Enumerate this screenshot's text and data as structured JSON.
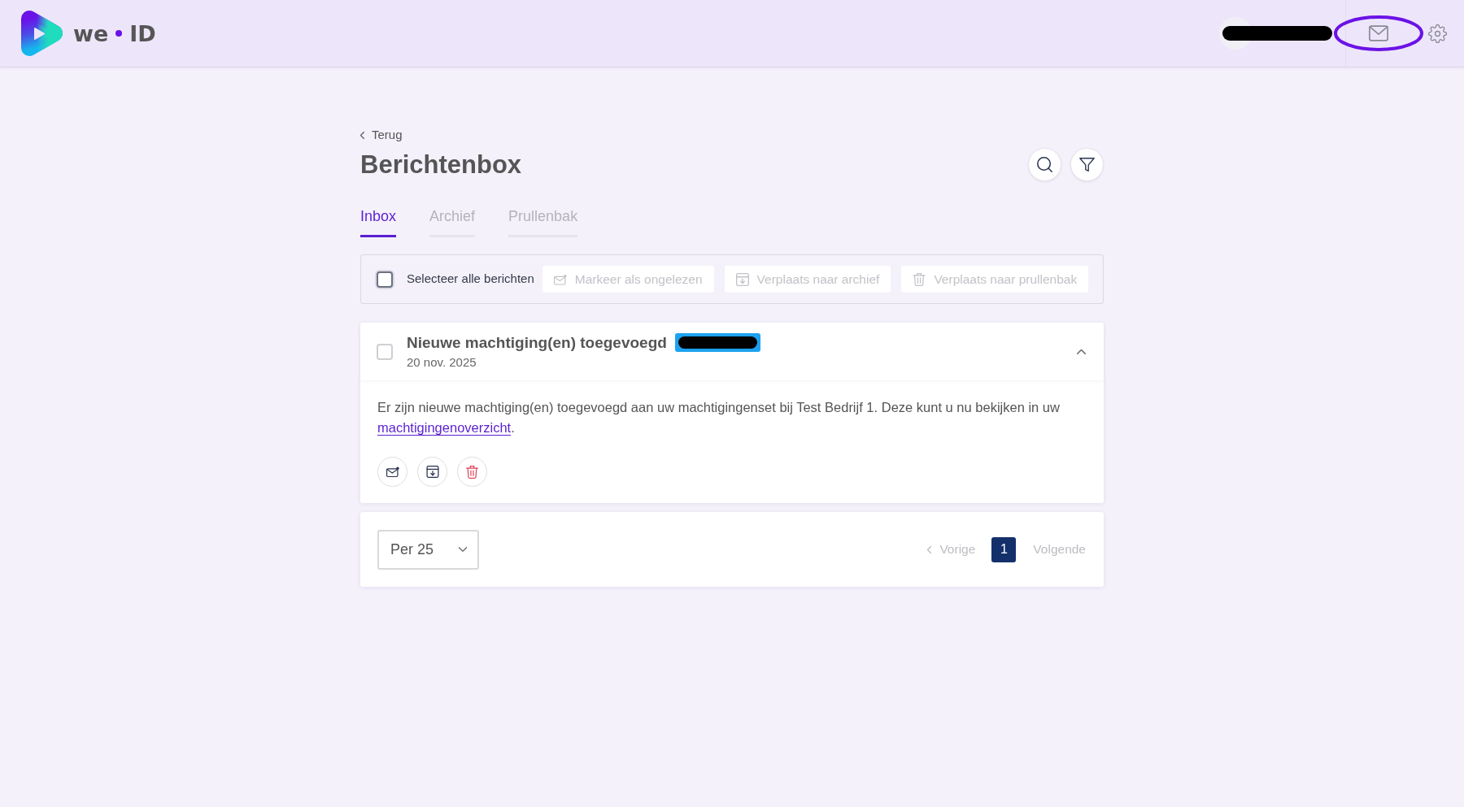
{
  "header": {
    "brand": {
      "left": "we",
      "right": "ID"
    },
    "user": {
      "redacted": true
    },
    "mail_button": {
      "highlighted": true
    }
  },
  "back_link": {
    "label": "Terug"
  },
  "title": "Berichtenbox",
  "tabs": [
    {
      "label": "Inbox",
      "selected": true
    },
    {
      "label": "Archief",
      "selected": false
    },
    {
      "label": "Prullenbak",
      "selected": false
    }
  ],
  "toolbar": {
    "select_all": {
      "label": "Selecteer alle berichten",
      "checked": false
    },
    "actions": [
      {
        "kind": "mark-unread",
        "label": "Markeer als ongelezen",
        "disabled": true
      },
      {
        "kind": "archive",
        "label": "Verplaats naar archief",
        "disabled": true
      },
      {
        "kind": "trash",
        "label": "Verplaats naar prullenbak",
        "disabled": true
      }
    ]
  },
  "messages": [
    {
      "title": "Nieuwe machtiging(en) toegevoegd",
      "badge_redacted": true,
      "date": "20 nov. 2025",
      "checked": false,
      "expanded": true,
      "body": {
        "text": "Er zijn nieuwe machtiging(en) toegevoegd aan uw machtigingenset bij Test Bedrijf 1. Deze kunt u nu bekijken in uw",
        "link": "machtigingenoverzicht",
        "after": "."
      },
      "actions": [
        {
          "kind": "mark-unread"
        },
        {
          "kind": "archive"
        },
        {
          "kind": "trash"
        }
      ]
    }
  ],
  "pagination": {
    "per_page": "Per 25",
    "previous": {
      "label": "Vorige",
      "disabled": true
    },
    "pages": [
      {
        "label": "1",
        "selected": true
      }
    ],
    "next": {
      "label": "Volgende",
      "disabled": true
    }
  }
}
